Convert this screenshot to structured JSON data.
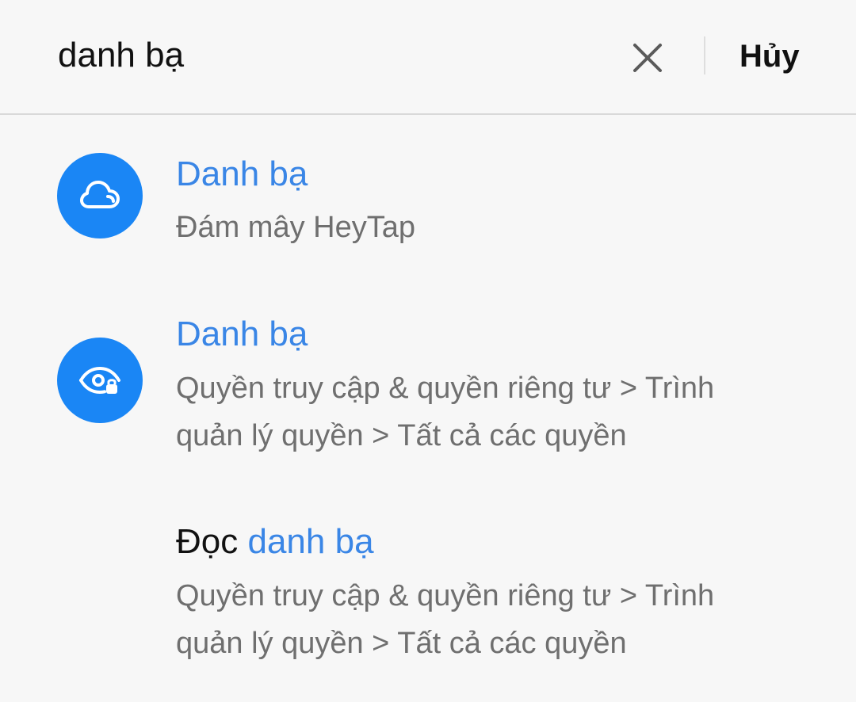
{
  "search": {
    "query": "danh bạ",
    "cancel_label": "Hủy"
  },
  "results": [
    {
      "icon": "cloud-icon",
      "title": "Danh bạ",
      "subtitle": "Đám mây HeyTap"
    },
    {
      "icon": "privacy-eye-lock-icon",
      "title": "Danh bạ",
      "subtitle": "Quyền truy cập & quyền riêng tư > Trình quản lý quyền > Tất cả các quyền"
    },
    {
      "title_prefix": "Đọc ",
      "title_highlight": "danh bạ",
      "subtitle": "Quyền truy cập & quyền riêng tư > Trình quản lý quyền > Tất cả các quyền"
    }
  ],
  "colors": {
    "accent": "#1a86f5",
    "highlight_text": "#3a86e6",
    "secondary_text": "#6f6f6f",
    "background": "#f7f7f7"
  }
}
